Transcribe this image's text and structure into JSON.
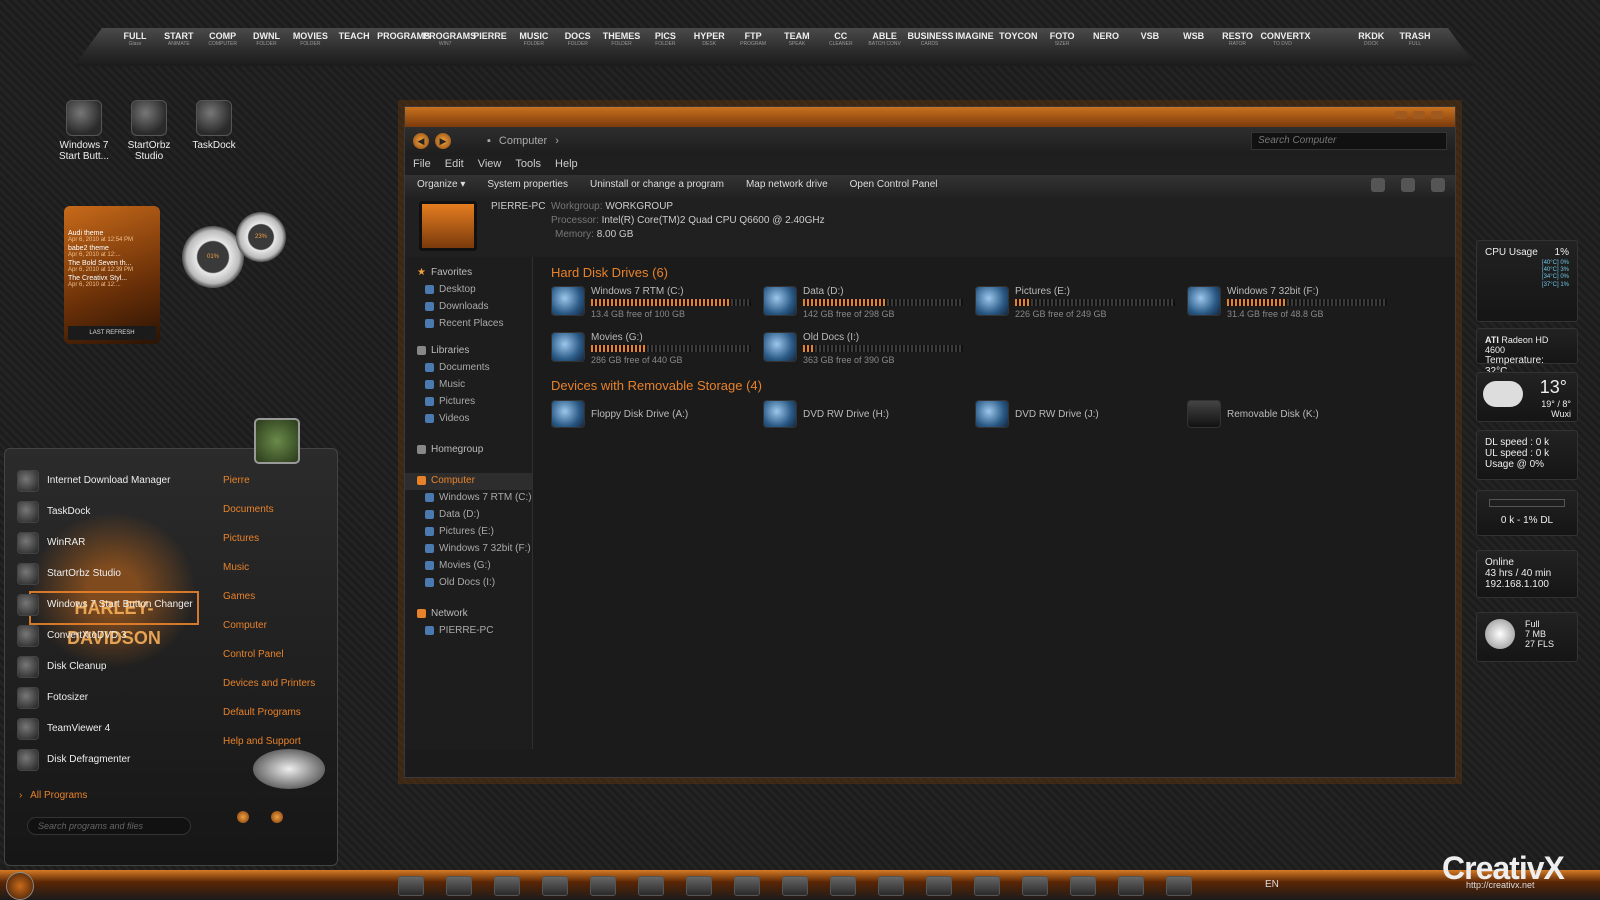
{
  "top_dock": [
    {
      "label": "FULL",
      "sub": "Glass"
    },
    {
      "label": "START",
      "sub": "ANIMATE"
    },
    {
      "label": "COMP",
      "sub": "COMPUTER"
    },
    {
      "label": "DWNL",
      "sub": "FOLDER"
    },
    {
      "label": "MOVIES",
      "sub": "FOLDER"
    },
    {
      "label": "TEACH",
      "sub": ""
    },
    {
      "label": "PROGRAMS",
      "sub": ""
    },
    {
      "label": "PROGRAMS",
      "sub": "WIN7"
    },
    {
      "label": "PIERRE",
      "sub": ""
    },
    {
      "label": "MUSIC",
      "sub": "FOLDER"
    },
    {
      "label": "DOCS",
      "sub": "FOLDER"
    },
    {
      "label": "THEMES",
      "sub": "FOLDER"
    },
    {
      "label": "PICS",
      "sub": "FOLDER"
    },
    {
      "label": "HYPER",
      "sub": "DESK"
    },
    {
      "label": "FTP",
      "sub": "PROGRAM"
    },
    {
      "label": "TEAM",
      "sub": "SPEAK"
    },
    {
      "label": "CC",
      "sub": "CLEANER"
    },
    {
      "label": "ABLE",
      "sub": "BATCH CONV"
    },
    {
      "label": "BUSINESS",
      "sub": "CARDS"
    },
    {
      "label": "IMAGINE",
      "sub": ""
    },
    {
      "label": "TOYCON",
      "sub": ""
    },
    {
      "label": "FOTO",
      "sub": "SIZER"
    },
    {
      "label": "NERO",
      "sub": ""
    },
    {
      "label": "VSB",
      "sub": ""
    },
    {
      "label": "WSB",
      "sub": ""
    },
    {
      "label": "RESTO",
      "sub": "RATOR"
    },
    {
      "label": "CONVERTX",
      "sub": "TO DVD"
    },
    {
      "label": "",
      "sub": ""
    },
    {
      "label": "RKDK",
      "sub": "DOCK"
    },
    {
      "label": "TRASH",
      "sub": "FULL"
    }
  ],
  "desktop_icons": [
    {
      "label": "Windows 7 Start Butt..."
    },
    {
      "label": "StartOrbz Studio"
    },
    {
      "label": "TaskDock"
    }
  ],
  "news_gadget": {
    "items": [
      {
        "title": "Audi theme",
        "date": "Apr 6, 2010 at 12:54 PM"
      },
      {
        "title": "babe2 theme",
        "date": "Apr 6, 2010 at 12:..."
      },
      {
        "title": "The Bold Seven th...",
        "date": "Apr 6, 2010 at 12:39 PM"
      },
      {
        "title": "The Creativx Styl...",
        "date": "Apr 6, 2010 at 12:..."
      }
    ],
    "footer": "LAST REFRESH"
  },
  "meters": {
    "left": "01%",
    "right": "23%"
  },
  "explorer": {
    "breadcrumb": "Computer",
    "search_placeholder": "Search Computer",
    "menu": [
      "File",
      "Edit",
      "View",
      "Tools",
      "Help"
    ],
    "commands": [
      "Organize ▾",
      "System properties",
      "Uninstall or change a program",
      "Map network drive",
      "Open Control Panel"
    ],
    "pc_name": "PIERRE-PC",
    "workgroup_label": "Workgroup:",
    "workgroup": "WORKGROUP",
    "processor_label": "Processor:",
    "processor": "Intel(R) Core(TM)2 Quad CPU    Q6600  @ 2.40GHz",
    "memory_label": "Memory:",
    "memory": "8.00 GB",
    "nav": {
      "favorites": "Favorites",
      "favorite_items": [
        "Desktop",
        "Downloads",
        "Recent Places"
      ],
      "libraries": "Libraries",
      "library_items": [
        "Documents",
        "Music",
        "Pictures",
        "Videos"
      ],
      "homegroup": "Homegroup",
      "computer": "Computer",
      "computer_items": [
        "Windows 7 RTM (C:)",
        "Data  (D:)",
        "Pictures (E:)",
        "Windows 7 32bit (F:)",
        "Movies (G:)",
        "Old Docs (I:)"
      ],
      "network": "Network",
      "network_items": [
        "PIERRE-PC"
      ]
    },
    "hdd_header": "Hard Disk Drives (6)",
    "drives": [
      {
        "name": "Windows 7 RTM (C:)",
        "free": "13.4 GB free of 100 GB",
        "used_pct": 86
      },
      {
        "name": "Data  (D:)",
        "free": "142 GB free of 298 GB",
        "used_pct": 52
      },
      {
        "name": "Pictures (E:)",
        "free": "226 GB free of 249 GB",
        "used_pct": 9
      },
      {
        "name": "Windows 7 32bit (F:)",
        "free": "31.4 GB free of 48.8 GB",
        "used_pct": 36
      },
      {
        "name": "Movies (G:)",
        "free": "286 GB free of 440 GB",
        "used_pct": 35
      },
      {
        "name": "Old Docs (I:)",
        "free": "363 GB free of 390 GB",
        "used_pct": 7
      }
    ],
    "removable_header": "Devices with Removable Storage (4)",
    "removable": [
      "Floppy Disk Drive (A:)",
      "DVD RW Drive (H:)",
      "DVD RW Drive (J:)",
      "Removable Disk (K:)"
    ]
  },
  "start_menu": {
    "programs": [
      "Internet Download Manager",
      "TaskDock",
      "WinRAR",
      "StartOrbz Studio",
      "Windows 7 Start Button Changer",
      "ConvertXtoDVD 3",
      "Disk Cleanup",
      "Fotosizer",
      "TeamViewer 4",
      "Disk Defragmenter"
    ],
    "all_programs": "All Programs",
    "search_placeholder": "Search programs and files",
    "places": [
      "Pierre",
      "Documents",
      "Pictures",
      "Music",
      "Games",
      "Computer",
      "Control Panel",
      "Devices and Printers",
      "Default Programs",
      "Help and Support"
    ],
    "logo_text": "HARLEY-DAVIDSON"
  },
  "gadgets": {
    "cpu": {
      "title": "CPU Usage",
      "value": "1%",
      "cores": [
        "[40°C]  0%",
        "[40°C]  3%",
        "[34°C]  0%",
        "[37°C]  1%"
      ]
    },
    "gpu": {
      "name": "Radeon HD 4600",
      "temp_label": "Temperature:",
      "temp": "32°C"
    },
    "weather": {
      "temp": "13°",
      "range": "19° / 8°",
      "city": "Wuxi"
    },
    "net": {
      "dl": "DL speed : 0 k",
      "ul": "UL speed : 0 k",
      "usage": "Usage @ 0%"
    },
    "bandwidth": {
      "label": "0 k - 1% DL"
    },
    "online": {
      "status": "Online",
      "time": "43 hrs / 40 min",
      "ip": "192.168.1.100"
    },
    "recycle": {
      "state": "Full",
      "size": "7 MB",
      "files": "27 FLS"
    }
  },
  "taskbar": {
    "lang": "EN"
  },
  "watermark": {
    "brand": "CreativX",
    "url": "http://creativx.net"
  },
  "colors": {
    "accent": "#e8822a",
    "bg": "#1e1e1e"
  }
}
